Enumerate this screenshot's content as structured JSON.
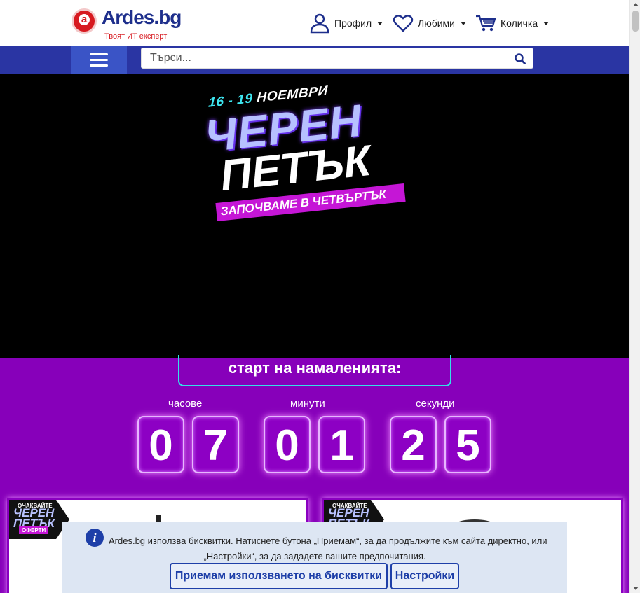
{
  "header": {
    "logo_name": "Ardes.bg",
    "logo_tagline": "Твоят ИТ експерт",
    "logo_letter": "a",
    "nav": {
      "profile": "Профил",
      "favorites": "Любими",
      "cart": "Количка"
    }
  },
  "search": {
    "placeholder": "Търси..."
  },
  "hero": {
    "dates_prefix": "16 - 19",
    "dates_month": "НОЕМВРИ",
    "line1": "ЧЕРЕН",
    "line2": "ПЕТЪК",
    "strip_prefix": "ЗАПОЧВАМЕ В",
    "strip_day": "ЧЕТВЪРТЪК"
  },
  "countdown": {
    "label": "старт на намаленията:",
    "units": {
      "hours": "часове",
      "minutes": "минути",
      "seconds": "секунди"
    },
    "digits": [
      "0",
      "7",
      "0",
      "1",
      "2",
      "5"
    ]
  },
  "cards": {
    "badge_top": "ОЧАКВАЙТЕ",
    "badge_main": "ЧЕРЕН ПЕТЪК",
    "badge_bottom": "ОФЕРТИ"
  },
  "cookie": {
    "text_line1": "Ardes.bg използва бисквитки. Натиснете бутона „Приемам“, за да продължите към сайта директно, или",
    "text_line2": "„Настройки“, за да зададете вашите предпочитания.",
    "info_icon": "i",
    "accept_button": "Приемам използването на бисквитки",
    "settings_button": "Настройки"
  },
  "colors": {
    "brand_blue": "#2a35a3",
    "brand_red": "#d71a20",
    "promo_purple": "#8700ba",
    "accent_cyan": "#34e0e8",
    "accent_magenta": "#c516d6"
  }
}
